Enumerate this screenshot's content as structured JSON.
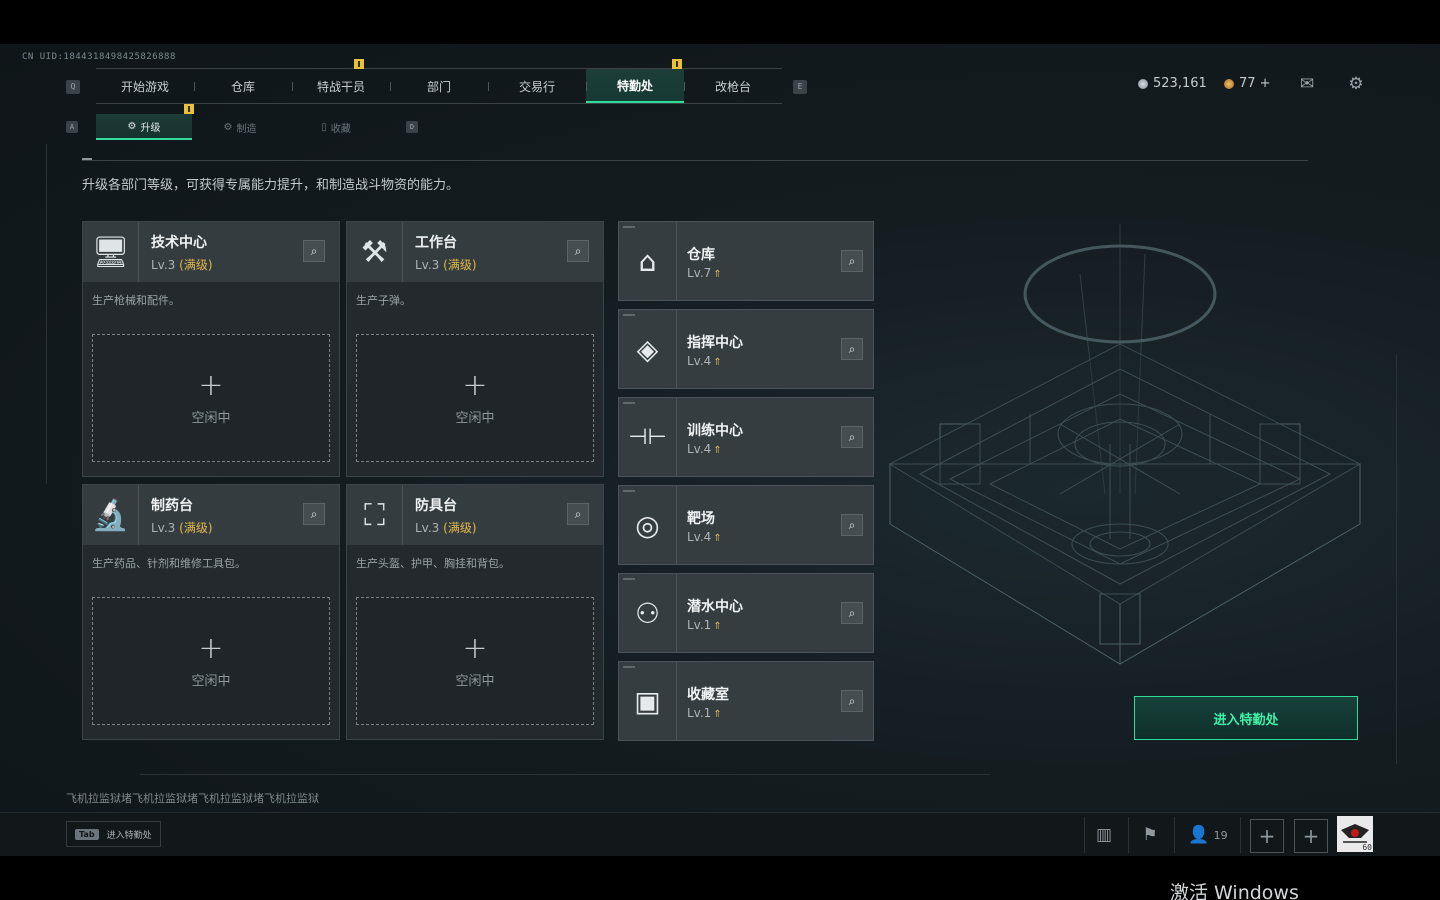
{
  "header": {
    "uid": "CN UID:1844318498425826888",
    "nav_key_left": "Q",
    "nav_key_right": "E",
    "tabs": [
      {
        "label": "开始游戏",
        "notif": false
      },
      {
        "label": "仓库",
        "notif": false
      },
      {
        "label": "特战干员",
        "notif": true
      },
      {
        "label": "部门",
        "notif": false
      },
      {
        "label": "交易行",
        "notif": false
      },
      {
        "label": "特勤处",
        "notif": true,
        "active": true
      },
      {
        "label": "改枪台",
        "notif": false
      }
    ],
    "currency_1": "523,161",
    "currency_2": "77 +",
    "mail_icon": "mail-icon",
    "settings_icon": "gear-icon"
  },
  "subtabs": {
    "key_left": "A",
    "key_right": "D",
    "items": [
      {
        "label": "升级",
        "active": true,
        "notif": true
      },
      {
        "label": "制造",
        "active": false
      },
      {
        "label": "收藏",
        "active": false
      }
    ]
  },
  "description": "升级各部门等级，可获得专属能力提升，和制造战斗物资的能力。",
  "workstations": [
    {
      "name": "技术中心",
      "level": "Lv.3",
      "max": "(满级)",
      "desc": "生产枪械和配件。",
      "icon": "computer-icon",
      "slot_status": "空闲中"
    },
    {
      "name": "工作台",
      "level": "Lv.3",
      "max": "(满级)",
      "desc": "生产子弹。",
      "icon": "tools-icon",
      "slot_status": "空闲中"
    },
    {
      "name": "制药台",
      "level": "Lv.3",
      "max": "(满级)",
      "desc": "生产药品、针剂和维修工具包。",
      "icon": "microscope-icon",
      "slot_status": "空闲中"
    },
    {
      "name": "防具台",
      "level": "Lv.3",
      "max": "(满级)",
      "desc": "生产头盔、护甲、胸挂和背包。",
      "icon": "armor-icon",
      "slot_status": "空闲中"
    }
  ],
  "departments": [
    {
      "name": "仓库",
      "level": "Lv.7",
      "icon": "warehouse-icon",
      "glyph": "⌂"
    },
    {
      "name": "指挥中心",
      "level": "Lv.4",
      "icon": "command-icon",
      "glyph": "◈"
    },
    {
      "name": "训练中心",
      "level": "Lv.4",
      "icon": "dumbbell-icon",
      "glyph": "⊣⊢"
    },
    {
      "name": "靶场",
      "level": "Lv.4",
      "icon": "target-icon",
      "glyph": "◎"
    },
    {
      "name": "潜水中心",
      "level": "Lv.1",
      "icon": "diving-mask-icon",
      "glyph": "⚇"
    },
    {
      "name": "收藏室",
      "level": "Lv.1",
      "icon": "collection-icon",
      "glyph": "▣"
    }
  ],
  "enter_button": "进入特勤处",
  "marquee": "飞机拉监狱堵飞机拉监狱堵飞机拉监狱堵飞机拉监狱",
  "bottom": {
    "tab_key": "Tab",
    "tab_label": "进入特勤处",
    "friends_count": "19",
    "avatar_level": "60"
  },
  "watermark": "激活 Windows",
  "colors": {
    "accent": "#2fdc9a",
    "max_level": "#e0b94a",
    "notif": "#e8c13c"
  }
}
